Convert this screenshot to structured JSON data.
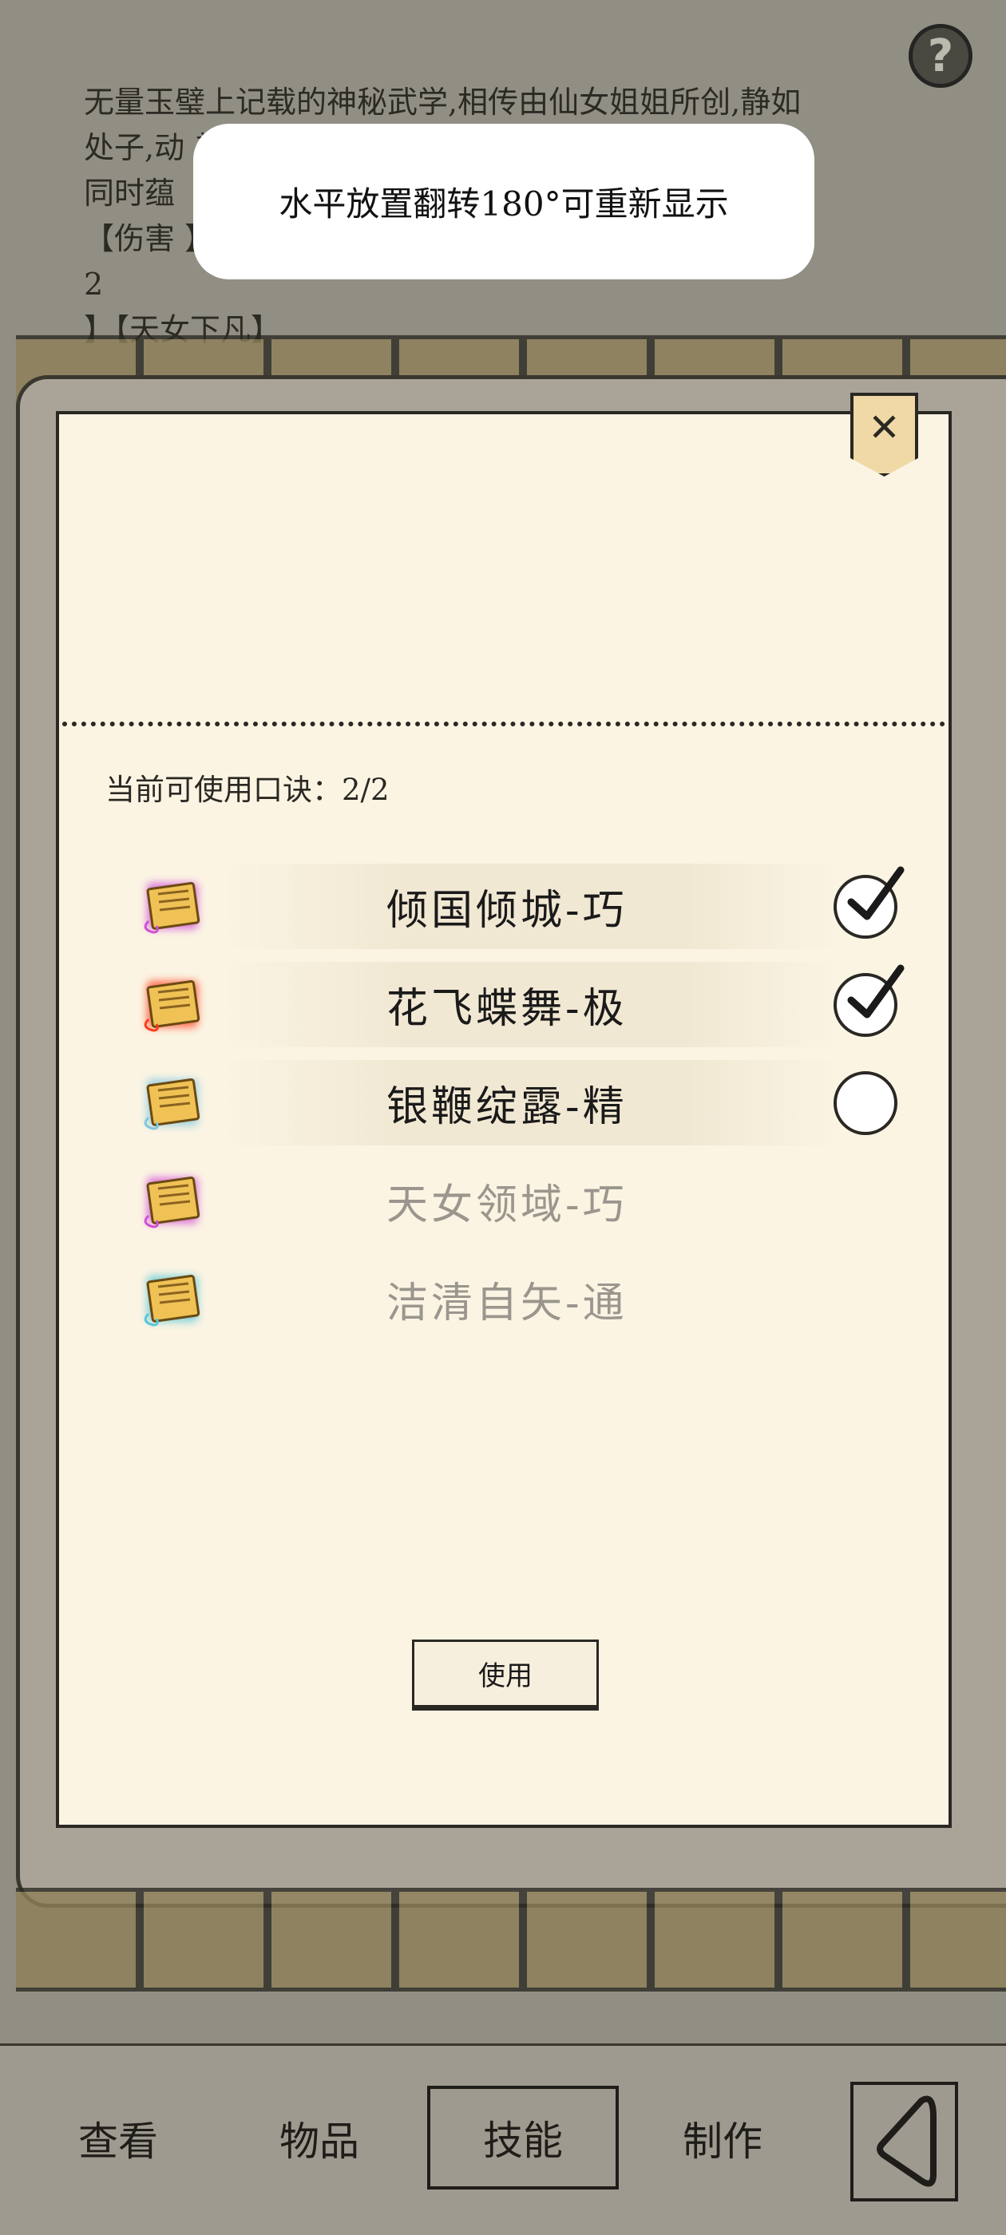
{
  "background": {
    "text_lines": [
      "无量玉璧上记载的神秘武学,相传由仙女姐姐所创,静如",
      "处子,动                                                  美妙的",
      "同时蕴",
      "【伤害                                                  】很多,",
      "                2",
      "                        】【天女下凡】"
    ],
    "help_label": "?"
  },
  "toast": {
    "message": "水平放置翻转180°可重新显示"
  },
  "modal": {
    "close_label": "✕",
    "count_label": "当前可使用口诀：2/2",
    "skills": [
      {
        "name": "倾国倾城-巧",
        "checked": true,
        "enabled": true,
        "icon": "scroll-icon",
        "glow": "#d24fd6"
      },
      {
        "name": "花飞蝶舞-极",
        "checked": true,
        "enabled": true,
        "icon": "scroll-icon",
        "glow": "#ff3c1c"
      },
      {
        "name": "银鞭绽露-精",
        "checked": false,
        "enabled": true,
        "icon": "scroll-icon",
        "glow": "#7fc6e0"
      },
      {
        "name": "天女领域-巧",
        "checked": false,
        "enabled": false,
        "icon": "scroll-icon",
        "glow": "#d24fd6"
      },
      {
        "name": "洁清自矢-通",
        "checked": false,
        "enabled": false,
        "icon": "scroll-icon",
        "glow": "#58c6d8"
      }
    ],
    "use_button": "使用"
  },
  "nav": {
    "items": [
      "查看",
      "物品",
      "技能",
      "制作"
    ],
    "active": "技能"
  }
}
